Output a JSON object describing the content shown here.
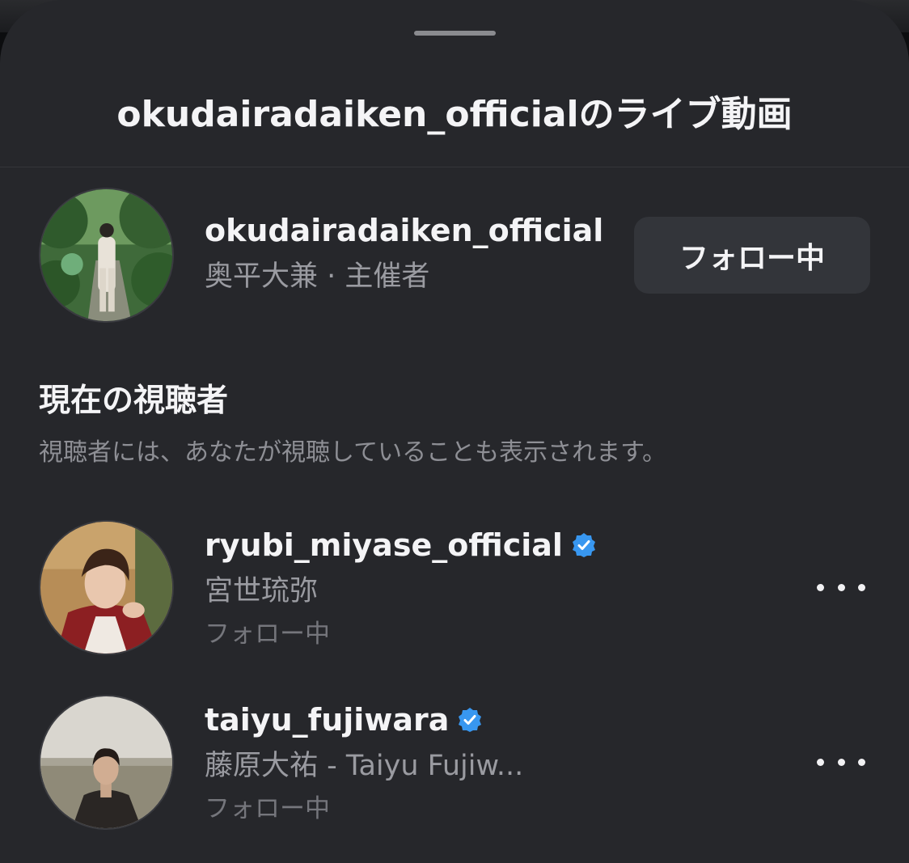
{
  "sheet": {
    "title": "okudairadaiken_officialのライブ動画"
  },
  "host": {
    "username": "okudairadaiken_official",
    "subtitle": "奥平大兼 · 主催者",
    "follow_label": "フォロー中",
    "avatar_icon": "profile-photo-garden"
  },
  "viewers_section": {
    "title": "現在の視聴者",
    "description": "視聴者には、あなたが視聴していることも表示されます。"
  },
  "viewers": [
    {
      "username": "ryubi_miyase_official",
      "display_name": "宮世琉弥",
      "status": "フォロー中",
      "verified": true,
      "avatar_icon": "profile-photo-portrait"
    },
    {
      "username": "taiyu_fujiwara",
      "display_name": "藤原大祐 - Taiyu Fujiw...",
      "status": "フォロー中",
      "verified": true,
      "avatar_icon": "profile-photo-beach"
    }
  ],
  "colors": {
    "sheet_background": "#26272b",
    "button_background": "#33353a",
    "verified_blue": "#3897f0",
    "primary_text": "#f4f4f6",
    "secondary_text": "#9a9ba1"
  }
}
